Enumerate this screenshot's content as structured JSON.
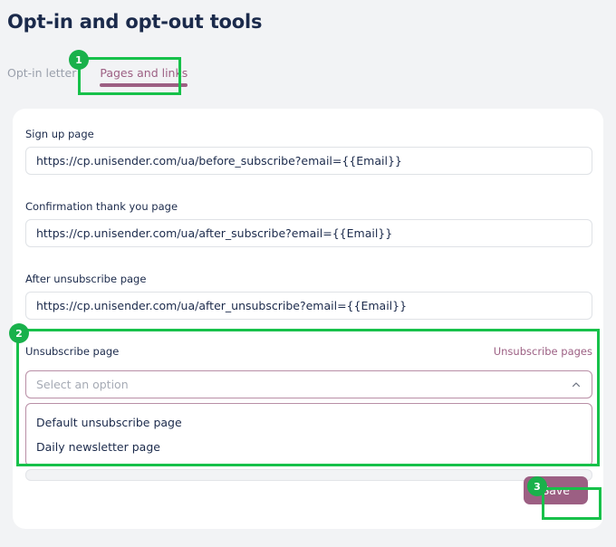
{
  "page": {
    "title": "Opt-in and opt-out tools"
  },
  "tabs": [
    {
      "label": "Opt-in letter",
      "active": false
    },
    {
      "label": "Pages and links",
      "active": true
    }
  ],
  "form": {
    "fields": [
      {
        "label": "Sign up page",
        "value": "https://cp.unisender.com/ua/before_subscribe?email={{Email}}",
        "placeholder": ""
      },
      {
        "label": "Confirmation thank you page",
        "value": "https://cp.unisender.com/ua/after_subscribe?email={{Email}}",
        "placeholder": ""
      },
      {
        "label": "After unsubscribe page",
        "value": "https://cp.unisender.com/ua/after_unsubscribe?email={{Email}}",
        "placeholder": ""
      }
    ],
    "unsubscribe": {
      "label": "Unsubscribe page",
      "link_label": "Unsubscribe pages",
      "select_placeholder": "Select an option",
      "select_value": "",
      "expanded": true,
      "caret_icon": "chevron-up-icon",
      "options": [
        "Default unsubscribe page",
        "Daily newsletter page"
      ]
    },
    "save_label": "Save"
  },
  "annotations": [
    {
      "number": "1",
      "target": "tab-pages-and-links"
    },
    {
      "number": "2",
      "target": "unsubscribe-page-block"
    },
    {
      "number": "3",
      "target": "save-button"
    }
  ],
  "colors": {
    "accent": "#9c5f83",
    "annotation_green": "#17c14a",
    "badge_green": "#19b14b",
    "heading": "#1b2a4b",
    "page_background": "#f2f3f5",
    "card_background": "#ffffff"
  }
}
